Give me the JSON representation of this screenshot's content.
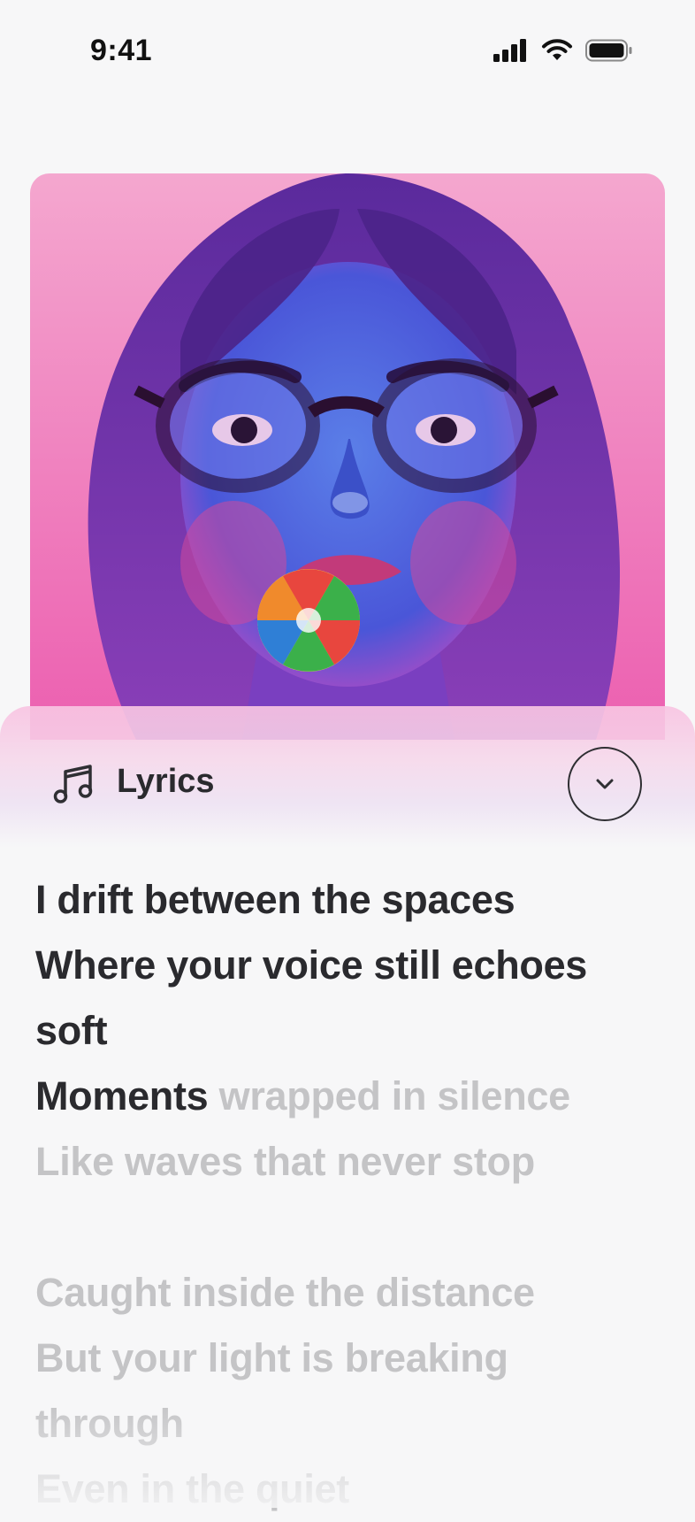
{
  "status_bar": {
    "time": "9:41",
    "icons": [
      "cellular-signal-icon",
      "wifi-icon",
      "battery-icon"
    ]
  },
  "album_art": {
    "description_icon": "album-artwork"
  },
  "lyrics_panel": {
    "title": "Lyrics",
    "icon": "music-note-icon",
    "collapse_icon": "chevron-down-icon",
    "lines": [
      {
        "text": "I drift between the spaces"
      },
      {
        "text": "Where your voice still echoes"
      },
      {
        "text": "soft"
      },
      {
        "sung": "Moments",
        "unsung": " wrapped in silence"
      },
      {
        "text": "Like waves that never stop"
      },
      {
        "text": "Caught inside the distance"
      },
      {
        "text": "But your light is breaking"
      },
      {
        "text": "through"
      },
      {
        "text": "Even in the quiet"
      }
    ]
  },
  "colors": {
    "background": "#f7f7f8",
    "active_lyric": "#2a2a2e",
    "inactive_lyric": "#c4c4c6",
    "sheet_tint": "#f8c4e2"
  }
}
